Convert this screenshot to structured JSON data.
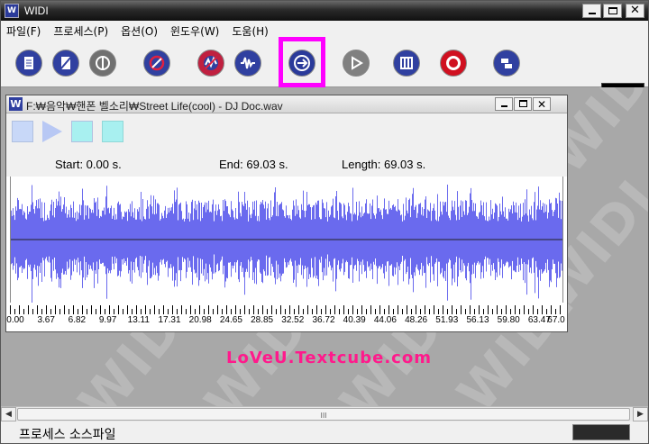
{
  "app": {
    "title": "WIDI",
    "icon_text": "W"
  },
  "menu": [
    {
      "label": "파일(F)"
    },
    {
      "label": "프로세스(P)"
    },
    {
      "label": "옵션(O)"
    },
    {
      "label": "윈도우(W)"
    },
    {
      "label": "도움(H)"
    }
  ],
  "toolbar": {
    "tools": [
      {
        "icon": "document-icon",
        "bg": "#3040a0"
      },
      {
        "icon": "slash-document-icon",
        "bg": "#3040a0"
      },
      {
        "icon": "logo-icon",
        "bg": "#707070"
      },
      {
        "icon": "no-entry-icon",
        "bg": "#3040a0"
      },
      {
        "icon": "stop-wave-icon",
        "bg": "#c02040"
      },
      {
        "icon": "waveform-icon",
        "bg": "#3040a0"
      },
      {
        "icon": "arrow-right-icon",
        "bg": "#2a3a9a"
      },
      {
        "icon": "playback-icon",
        "bg": "#808080"
      },
      {
        "icon": "piano-icon",
        "bg": "#3040a0"
      },
      {
        "icon": "record-icon",
        "bg": "#d01020"
      },
      {
        "icon": "convert-icon",
        "bg": "#3040a0"
      }
    ],
    "logo": "WIDI logo"
  },
  "child_window": {
    "title": "F:₩음악₩핸폰 벨소리₩Street Life(cool) - DJ Doc.wav",
    "icon_text": "W",
    "start": "Start: 0.00 s.",
    "end": "End: 69.03 s.",
    "length": "Length: 69.03 s.",
    "ruler_labels": [
      "0.00",
      "3.67",
      "6.82",
      "9.97",
      "13.11",
      "17.31",
      "20.98",
      "24.65",
      "28.85",
      "32.52",
      "36.72",
      "40.39",
      "44.06",
      "48.26",
      "51.93",
      "56.13",
      "59.80",
      "63.47",
      "67.0"
    ],
    "wave_color": "#6a6aee"
  },
  "watermark_text": "WIDI",
  "overlay_text": "LoVeU.Textcube.com",
  "scrollbar_grip": "III",
  "status": {
    "text": "프로세스 소스파일"
  }
}
